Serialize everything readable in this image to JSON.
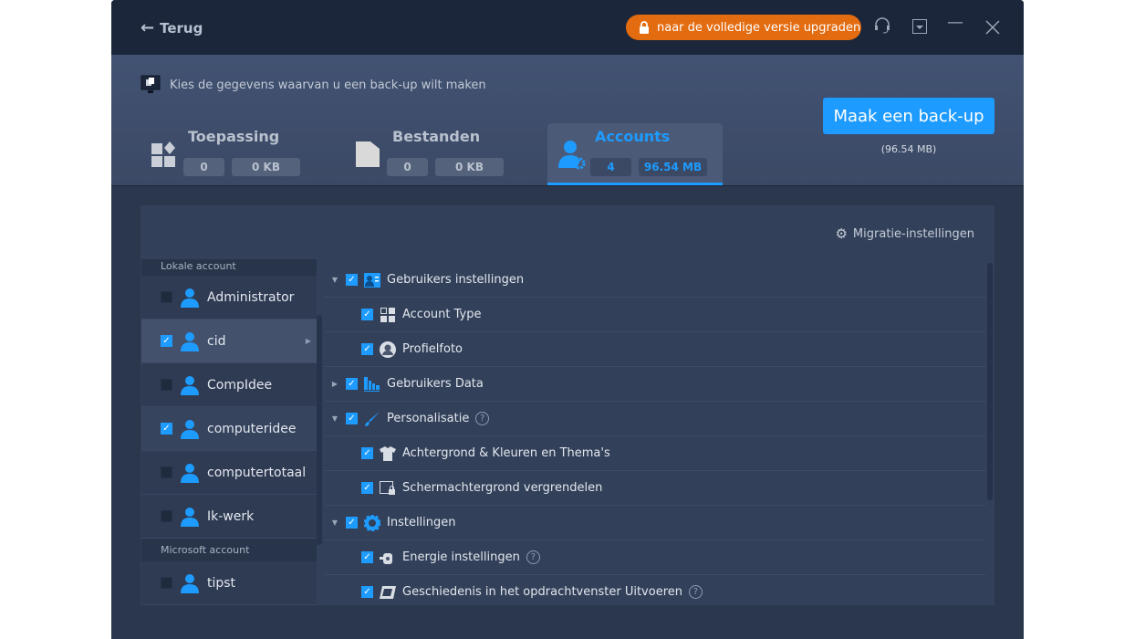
{
  "header": {
    "back_label": "Terug",
    "upgrade_label": "naar de volledige versie upgraden"
  },
  "top": {
    "hint": "Kies de gegevens waarvan u een back-up wilt maken",
    "tabs": [
      {
        "label": "Toepassing",
        "count": "0",
        "size": "0 KB"
      },
      {
        "label": "Bestanden",
        "count": "0",
        "size": "0 KB"
      },
      {
        "label": "Accounts",
        "count": "4",
        "size": "96.54 MB"
      }
    ],
    "backup_button": "Maak een back-up",
    "backup_size": "(96.54 MB)"
  },
  "panel": {
    "migration_settings": "Migratie-instellingen",
    "groups": [
      {
        "label": "Lokale account"
      },
      {
        "label": "Microsoft account"
      }
    ],
    "accounts": [
      {
        "name": "Administrator",
        "checked": false
      },
      {
        "name": "cid",
        "checked": true
      },
      {
        "name": "CompIdee",
        "checked": false
      },
      {
        "name": "computeridee",
        "checked": true
      },
      {
        "name": "computertotaal",
        "checked": false
      },
      {
        "name": "Ik-werk",
        "checked": false
      },
      {
        "name": "tipst",
        "checked": false
      }
    ],
    "tree": [
      {
        "label": "Gebruikers instellingen",
        "icon": "user-card-icon"
      },
      {
        "label": "Account Type",
        "icon": "grid-icon"
      },
      {
        "label": "Profielfoto",
        "icon": "profile-photo-icon"
      },
      {
        "label": "Gebruikers Data",
        "icon": "bar-chart-icon"
      },
      {
        "label": "Personalisatie",
        "icon": "brush-icon"
      },
      {
        "label": "Achtergrond & Kleuren en Thema's",
        "icon": "shirt-icon"
      },
      {
        "label": "Schermachtergrond vergrendelen",
        "icon": "lock-screen-icon"
      },
      {
        "label": "Instellingen",
        "icon": "gear-icon"
      },
      {
        "label": "Energie instellingen",
        "icon": "power-icon"
      },
      {
        "label": "Geschiedenis in het opdrachtvenster Uitvoeren",
        "icon": "run-window-icon"
      }
    ]
  },
  "colors": {
    "accent": "#1e9bff",
    "upgrade": "#e36b10"
  }
}
